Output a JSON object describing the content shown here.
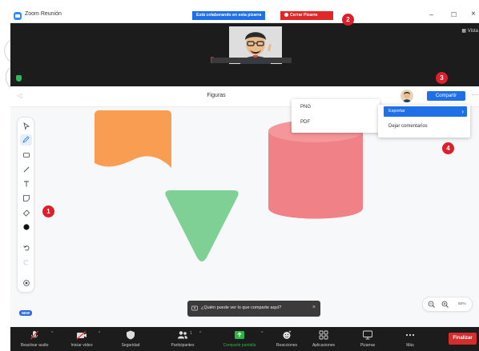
{
  "window": {
    "title": "Zoom Reunión",
    "collab_banner": "Está colaborando en esta pizarra",
    "close_whiteboard": "Cerrar Pizarra",
    "controls": {
      "minimize": "–",
      "maximize": "☐",
      "close": "×"
    }
  },
  "video": {
    "view_label": "Vista"
  },
  "whiteboard": {
    "title": "Figuras",
    "back": "◁",
    "share_label": "Compartir",
    "more": "···",
    "new_badge": "NEW"
  },
  "tools": [
    "select",
    "pen",
    "shape",
    "line",
    "text",
    "sticky-note",
    "eraser",
    "color",
    "undo",
    "redo",
    "history"
  ],
  "shapes": [
    {
      "type": "wave",
      "color": "#f99d52"
    },
    {
      "type": "triangle",
      "color": "#7fd095"
    },
    {
      "type": "cylinder",
      "color": "#f08186"
    }
  ],
  "export_menu": {
    "items": [
      "PNG",
      "PDF"
    ]
  },
  "options_menu": {
    "export_label": "Exportar",
    "comments_label": "Dejar comentarios"
  },
  "markers": [
    "1",
    "2",
    "3",
    "4"
  ],
  "toast": {
    "text": "¿Quién puede ver lo que comparte aquí?",
    "close": "×"
  },
  "zoom": {
    "level": "50%"
  },
  "toolbar": {
    "buttons": [
      {
        "label": "Reactivar audio",
        "icon": "mic-muted-icon"
      },
      {
        "label": "Iniciar vídeo",
        "icon": "video-off-icon"
      },
      {
        "label": "Seguridad",
        "icon": "shield-icon"
      },
      {
        "label": "Participantes",
        "icon": "participants-icon",
        "count": "1"
      },
      {
        "label": "Compartir pantalla",
        "icon": "share-screen-icon"
      },
      {
        "label": "Reacciones",
        "icon": "reactions-icon"
      },
      {
        "label": "Aplicaciones",
        "icon": "apps-icon"
      },
      {
        "label": "Pizarras",
        "icon": "whiteboard-icon"
      },
      {
        "label": "Más",
        "icon": "more-icon"
      }
    ],
    "end_label": "Finalizar"
  },
  "colors": {
    "accent": "#1f6fe6",
    "danger": "#de1e2a",
    "share_green": "#2fb344"
  }
}
